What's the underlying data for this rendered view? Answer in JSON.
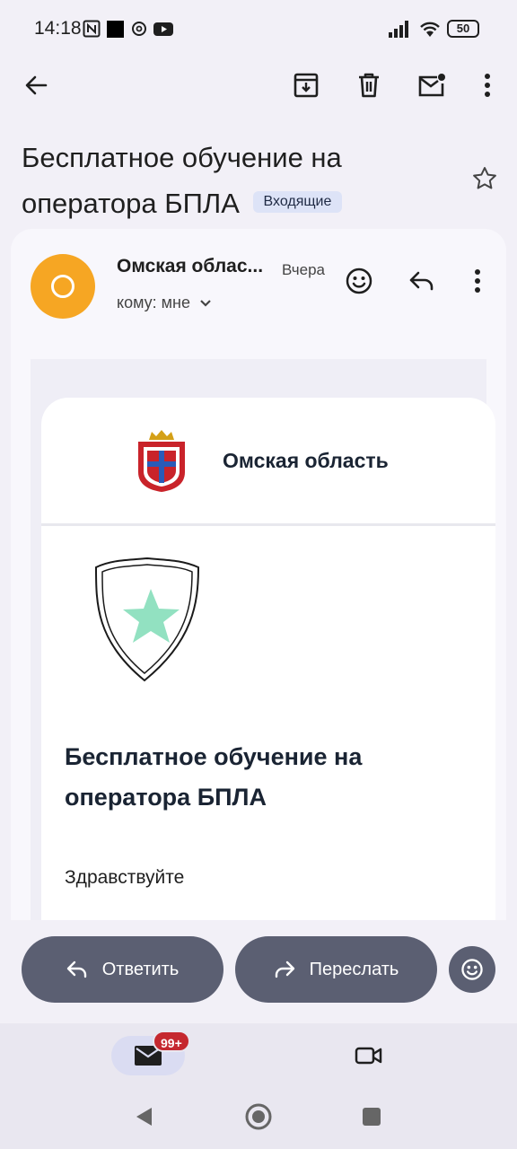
{
  "status_bar": {
    "time": "14:18",
    "battery": "50",
    "icons": [
      "nfc-icon",
      "black-square-icon",
      "threads-icon",
      "youtube-icon",
      "signal-icon",
      "wifi-icon",
      "battery-icon"
    ]
  },
  "toolbar": {
    "icons": [
      "back-arrow-icon",
      "archive-icon",
      "delete-icon",
      "mark-unread-icon",
      "more-vert-icon"
    ]
  },
  "message": {
    "subject": "Бесплатное обучение на оператора БПЛА",
    "label": "Входящие",
    "sender": "Омская облас...",
    "date": "Вчера",
    "to": "кому: мне",
    "avatar_color": "#f6a623"
  },
  "email_body": {
    "org_name": "Омская область",
    "heading": "Бесплатное обучение на оператора БПЛА",
    "greeting": "Здравствуйте"
  },
  "actions": {
    "reply": "Ответить",
    "forward": "Переслать"
  },
  "bottom_nav": {
    "mail_badge": "99+"
  },
  "colors": {
    "pill": "#5b5f72",
    "badge": "#c5282f",
    "chip": "#dde3f7"
  }
}
